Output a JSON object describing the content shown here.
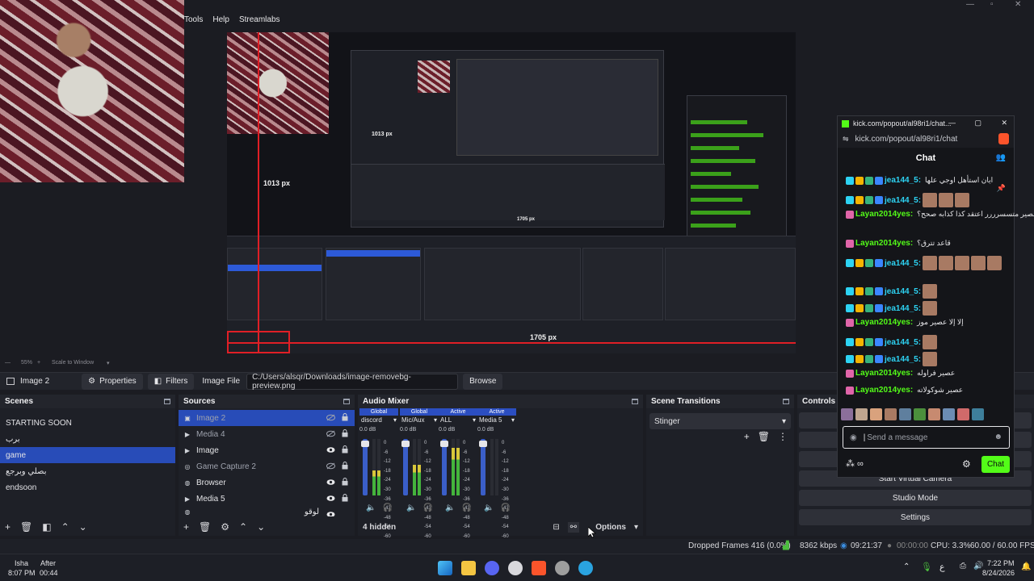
{
  "menu": {
    "tools": "Tools",
    "help": "Help",
    "streamlabs": "Streamlabs"
  },
  "preview": {
    "label_1013": "1013 px",
    "label_1705": "1705 px",
    "mini_1013": "1013 px",
    "mini_1705": "1705 px"
  },
  "zoom": {
    "level": "55%",
    "mode": "Scale to Window"
  },
  "props": {
    "source_name": "Image 2",
    "properties_label": "Properties",
    "filters_label": "Filters",
    "image_file_label": "Image File",
    "path": "C:/Users/alsqr/Downloads/image-removebg-preview.png",
    "browse_label": "Browse"
  },
  "scenes": {
    "title": "Scenes",
    "items": [
      "STARTING SOON",
      "برب",
      "game",
      "بصلي وبرجع",
      "endsoon"
    ],
    "selected": "game"
  },
  "sources": {
    "title": "Sources",
    "items": [
      {
        "label": "Image 2",
        "icon": "image-icon"
      },
      {
        "label": "Media 4",
        "icon": "play-icon"
      },
      {
        "label": "Image",
        "icon": "image-icon"
      },
      {
        "label": "Game Capture 2",
        "icon": "gamepad-icon"
      },
      {
        "label": "Browser",
        "icon": "globe-icon"
      },
      {
        "label": "Media 5",
        "icon": "play-icon"
      },
      {
        "label": "لوقو",
        "icon": "globe-icon"
      }
    ]
  },
  "mixer": {
    "title": "Audio Mixer",
    "channels": [
      {
        "tag": "Global",
        "name": "discord",
        "db": "0.0 dB",
        "level": 0.45
      },
      {
        "tag": "Global",
        "name": "Mic/Aux",
        "db": "0.0 dB",
        "level": 0.55
      },
      {
        "tag": "Active",
        "name": "ALL",
        "db": "0.0 dB",
        "level": 0.85
      },
      {
        "tag": "Active",
        "name": "Media 5",
        "db": "0.0 dB",
        "level": 0.0
      }
    ],
    "scale": [
      "0",
      "-6",
      "-12",
      "-18",
      "-24",
      "-30",
      "-36",
      "-42",
      "-48",
      "-54",
      "-60"
    ],
    "hidden": "4 hidden",
    "options": "Options"
  },
  "transitions": {
    "title": "Scene Transitions",
    "selected": "Stinger"
  },
  "controls": {
    "title": "Controls",
    "virtual_camera": "Start Virtual Camera",
    "studio_mode": "Studio Mode",
    "settings": "Settings"
  },
  "status": {
    "dropped": "Dropped Frames 416 (0.0%)",
    "bitrate": "8362 kbps",
    "stream_time": "09:21:37",
    "rec_time": "00:00:00",
    "cpu": "CPU: 3.3%",
    "fps": "60.00 / 60.00 FPS"
  },
  "prayer": {
    "name1": "Isha",
    "time1": "8:07 PM",
    "name2": "After",
    "time2": "00:44"
  },
  "taskbar": {
    "time": "7:22 PM",
    "date": "8/24/2026",
    "lang": "ع"
  },
  "chat": {
    "window_title": "kick.com/popout/al98ri1/chat...",
    "url": "kick.com/popout/al98ri1/chat",
    "header": "Chat",
    "messages": [
      {
        "user": "jea144_5:",
        "text": "ايان استأهل اوجي علها",
        "color": "cyan",
        "badges": 4
      },
      {
        "user": "jea144_5:",
        "text": "",
        "color": "cyan",
        "badges": 4,
        "emotes": 3
      },
      {
        "user": "Layan2014yes:",
        "text": "عصير متسسرررر اعتقد كذا كذابه صحح؟",
        "color": "green",
        "badges": 1
      },
      {
        "user": "Layan2014yes:",
        "text": "قاعد تترق؟",
        "color": "green",
        "badges": 1
      },
      {
        "user": "jea144_5:",
        "text": "",
        "color": "cyan",
        "badges": 4,
        "emotes": 5
      },
      {
        "user": "jea144_5:",
        "text": "",
        "color": "cyan",
        "badges": 4,
        "emotes": 1
      },
      {
        "user": "jea144_5:",
        "text": "",
        "color": "cyan",
        "badges": 4,
        "emotes": 1
      },
      {
        "user": "Layan2014yes:",
        "text": "إلا إلا عصير موز",
        "color": "green",
        "badges": 1
      },
      {
        "user": "jea144_5:",
        "text": "",
        "color": "cyan",
        "badges": 4,
        "emotes": 1
      },
      {
        "user": "jea144_5:",
        "text": "",
        "color": "cyan",
        "badges": 4,
        "emotes": 1
      },
      {
        "user": "Layan2014yes:",
        "text": "عصير فراوله",
        "color": "green",
        "badges": 1
      },
      {
        "user": "Layan2014yes:",
        "text": "عصير شوكولاته",
        "color": "green",
        "badges": 1
      }
    ],
    "placeholder": "Send a message",
    "send": "Chat"
  },
  "colors": {
    "accent": "#284cb8",
    "kick_green": "#53fc18",
    "guide_red": "#e01f26"
  }
}
